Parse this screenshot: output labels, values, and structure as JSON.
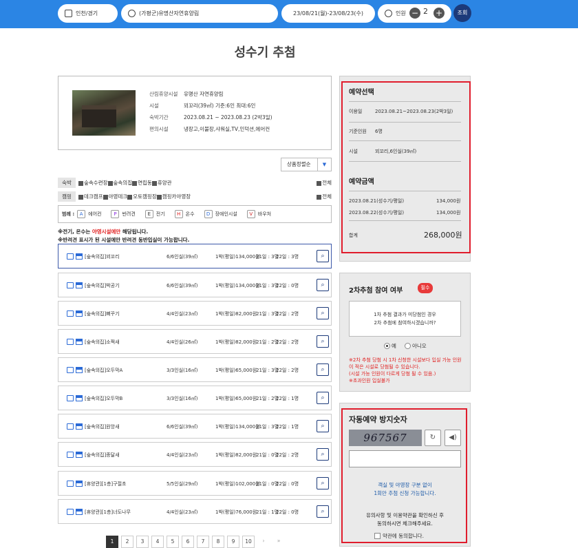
{
  "topbar": {
    "region": "인천/경기",
    "facility": "(가평군)유명산자연휴양림",
    "dates": "23/08/21(월)-23/08/23(수)",
    "people_label": "인원",
    "people_minus": "−",
    "people_count": "2",
    "people_plus": "+",
    "search": "조회"
  },
  "page_title": "성수기 추첨",
  "facility_info": {
    "rows": [
      {
        "k": "산림휴양시설",
        "v": "유명산 자연휴양림"
      },
      {
        "k": "시설",
        "v": "꾀꼬리(39㎡) 기준:6인 최대:6인"
      },
      {
        "k": "숙박기간",
        "v": "2023.08.21 ~ 2023.08.23 (2박3일)"
      },
      {
        "k": "편의시설",
        "v": "냉장고,이불장,샤워실,TV,인덕션,에어컨"
      }
    ]
  },
  "sort_label": "상품정렬순",
  "sort_arrow": "▼",
  "filters": {
    "stay_label": "숙박",
    "stay_items": [
      "숲속수련장",
      "숲속의집",
      "연립동",
      "휴양관"
    ],
    "camp_label": "캠핑",
    "camp_items": [
      "데크캠프",
      "야영데크",
      "오토캠핑장",
      "캠핑카야영장"
    ],
    "all": "전체"
  },
  "legend": {
    "label": "범례 :",
    "items": [
      {
        "icon": "A",
        "text": "에어컨"
      },
      {
        "icon": "P",
        "text": "반려견"
      },
      {
        "icon": "E",
        "text": "전기"
      },
      {
        "icon": "H",
        "text": "온수"
      },
      {
        "icon": "D",
        "text": "장애인시설"
      },
      {
        "icon": "V",
        "text": "바우처"
      }
    ]
  },
  "notices": {
    "n1_a": "※전기, 온수는 ",
    "n1_red": "야영시설에만",
    "n1_b": " 해당됩니다.",
    "n2": "※반려견 표시가 된 시설에만 반려견 동반입실이 가능합니다."
  },
  "items": [
    {
      "name": "[숲속의집]꾀꼬리",
      "cap": "6/6인실(39㎡)",
      "price": "1박(평일)134,000원",
      "d1": "21일 : 3명",
      "d2": "22일 : 3명"
    },
    {
      "name": "[숲속의집]박공기",
      "cap": "6/6인실(39㎡)",
      "price": "1박(평일)134,000원",
      "d1": "21일 : 3명",
      "d2": "22일 : 0명"
    },
    {
      "name": "[숲속의집]뻐꾸기",
      "cap": "4/4인실(23㎡)",
      "price": "1박(평일)82,000원",
      "d1": "21일 : 3명",
      "d2": "22일 : 2명"
    },
    {
      "name": "[숲속의집]소쩍새",
      "cap": "4/4인실(26㎡)",
      "price": "1박(평일)82,000원",
      "d1": "21일 : 2명",
      "d2": "22일 : 2명"
    },
    {
      "name": "[숲속의집]오두막A",
      "cap": "3/3인실(16㎡)",
      "price": "1박(평일)65,000원",
      "d1": "21일 : 3명",
      "d2": "22일 : 2명"
    },
    {
      "name": "[숲속의집]오두막B",
      "cap": "3/3인실(16㎡)",
      "price": "1박(평일)65,000원",
      "d1": "21일 : 2명",
      "d2": "22일 : 1명"
    },
    {
      "name": "[숲속의집]원앙새",
      "cap": "6/6인실(39㎡)",
      "price": "1박(평일)134,000원",
      "d1": "21일 : 3명",
      "d2": "22일 : 1명"
    },
    {
      "name": "[숲속의집]종달새",
      "cap": "4/4인실(23㎡)",
      "price": "1박(평일)82,000원",
      "d1": "21일 : 0명",
      "d2": "22일 : 2명"
    },
    {
      "name": "[휴양관][1층]구절초",
      "cap": "5/5인실(29㎡)",
      "price": "1박(평일)102,000원",
      "d1": "21일 : 0명",
      "d2": "22일 : 0명"
    },
    {
      "name": "[휴양관][1층]너도나무",
      "cap": "4/4인실(23㎡)",
      "price": "1박(평일)76,000원",
      "d1": "21일 : 1명",
      "d2": "22일 : 0명"
    }
  ],
  "pager": [
    "1",
    "2",
    "3",
    "4",
    "5",
    "6",
    "7",
    "8",
    "9",
    "10",
    "›",
    "»"
  ],
  "reservation": {
    "title": "예약선택",
    "rows": [
      {
        "k": "이용일",
        "v": "2023.08.21~2023.08.23(2박3일)"
      },
      {
        "k": "기준인원",
        "v": "6명"
      },
      {
        "k": "시설",
        "v": "꾀꼬리,6인실(39㎡)"
      }
    ],
    "price_title": "예약금액",
    "prices": [
      {
        "k": "2023.08.21(성수기/평일)",
        "v": "134,000원"
      },
      {
        "k": "2023.08.22(성수기/평일)",
        "v": "134,000원"
      }
    ],
    "total_label": "합계",
    "total": "268,000원"
  },
  "second_draw": {
    "title": "2차추첨 참여 여부",
    "badge": "필수",
    "line1": "1차 추첨 결과가 미당첨인 경우",
    "line2": "2차 추첨에 참여하시겠습니까?",
    "yes": "예",
    "no": "아니오",
    "warn": [
      "※2차 추첨 당첨 시 1차 신청한 시설보다 입실 가능 인원이 적은 시설로 당첨될 수 있습니다.",
      "(시설 가능 인원이 다르게 당첨 될 수 있음.)",
      "※초과인원 입실불가"
    ]
  },
  "captcha": {
    "title": "자동예약 방지숫자",
    "code": "967567",
    "refresh": "↻",
    "audio": "◀)",
    "note1": "객실 및 야영장 구분 없이",
    "note2": "1회만 추첨 신청 가능합니다.",
    "agree1": "유의사항 및 이용약관을 확인하신 후",
    "agree2": "동의하시면 체크해주세요.",
    "agree_check": "약관에 동의합니다."
  }
}
